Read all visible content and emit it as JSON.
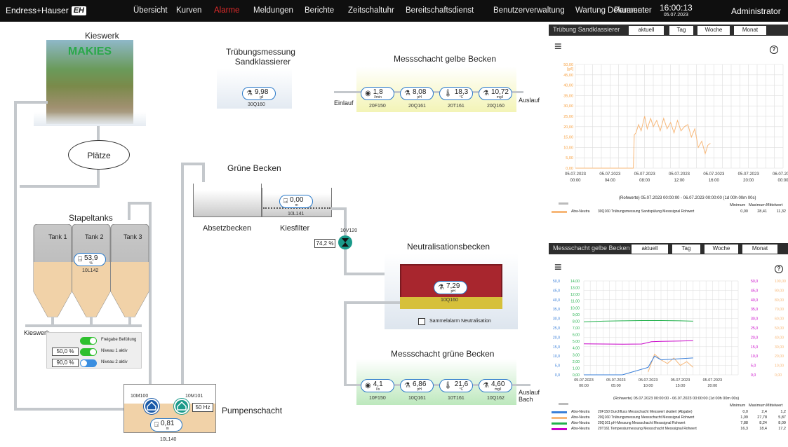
{
  "header": {
    "brand": "Endress+Hauser",
    "brand_logo": "EH",
    "nav": [
      "Übersicht",
      "Kurven",
      "Alarme",
      "Meldungen",
      "Berichte",
      "Zeitschaltuhr",
      "Bereitschaftsdienst",
      "Benutzerverwaltung",
      "Wartung",
      "Parameter",
      "Dokumente"
    ],
    "time": "16:00:13",
    "date": "05.07.2023",
    "user": "Administrator"
  },
  "plant": {
    "kieswerk": {
      "title": "Kieswerk",
      "logo": "MAKIES"
    },
    "plaetze": "Plätze",
    "truebung": {
      "title1": "Trübungsmessung",
      "title2": "Sandklassierer",
      "value": "9,98",
      "unit": "g/l",
      "tag": "30Q160"
    },
    "gelbe": {
      "title": "Messschacht gelbe Becken",
      "einlauf": "Einlauf",
      "auslauf": "Auslauf",
      "pills": [
        {
          "v": "1,8",
          "u": "l/min",
          "tag": "20F150"
        },
        {
          "v": "8,08",
          "u": "pH",
          "tag": "20Q161"
        },
        {
          "v": "18,3",
          "u": "°C",
          "tag": "20T161"
        },
        {
          "v": "10,72",
          "u": "mg/l",
          "tag": "20Q160"
        }
      ]
    },
    "gruene_becken": {
      "title": "Grüne Becken",
      "value": "0,00",
      "unit": "m",
      "tag": "10L141",
      "absetz": "Absetzbecken",
      "kies": "Kiesfilter"
    },
    "valve": {
      "tag": "10V120",
      "pct": "74,2 %"
    },
    "stapel": {
      "title": "Stapeltanks",
      "tanks": [
        "Tank 1",
        "Tank 2",
        "Tank 3"
      ],
      "value": "53,9",
      "unit": "%",
      "tag": "10L142"
    },
    "kieswerk_label": "Kieswerk",
    "controls": [
      {
        "pct": "",
        "label": "Freigabe Befüllung",
        "on": true
      },
      {
        "pct": "50,0 %",
        "label": "Niveau 1 aktiv",
        "on": true
      },
      {
        "pct": "90,0 %",
        "label": "Niveau 2 aktiv",
        "on": false
      }
    ],
    "neutral": {
      "title": "Neutralisationsbecken",
      "value": "7,29",
      "unit": "pH",
      "tag": "10Q160",
      "alarm": "Sammelalarm Neutralisation"
    },
    "gruen_schacht": {
      "title": "Messschacht grüne Becken",
      "auslauf1": "Auslauf",
      "auslauf2": "Bach",
      "pills": [
        {
          "v": "4,1",
          "u": "l/s",
          "tag": "10F150"
        },
        {
          "v": "6,86",
          "u": "pH",
          "tag": "10Q161"
        },
        {
          "v": "21,6",
          "u": "°C",
          "tag": "10T161"
        },
        {
          "v": "4,60",
          "u": "mg/l",
          "tag": "10Q162"
        }
      ]
    },
    "pump": {
      "title": "Pumpenschacht",
      "m1": "10M100",
      "m2": "10M101",
      "hz": "50 Hz",
      "value": "0,81",
      "unit": "m",
      "tag": "10L140"
    }
  },
  "panel1": {
    "title": "Trübung Sandklassierer",
    "tabs": [
      "aktuell",
      "Tag",
      "Woche",
      "Monat"
    ],
    "range": "(Rohwerte) 05.07.2023 00:00:00 - 06.07.2023 00:00:00 (1d 00h 00m 00s)",
    "stat_heads": [
      "Minimum",
      "Maximum",
      "Mittelwert"
    ],
    "legend": [
      {
        "src": "Abw-Neutra",
        "name": "30Q160 Trübungsmessung Sandspülung Messsignal Rohwert",
        "min": "0,00",
        "max": "28,41",
        "mean": "11,32",
        "color": "#f7b87a"
      }
    ]
  },
  "panel2": {
    "title": "Messschacht gelbe Becken",
    "tabs": [
      "aktuell",
      "Tag",
      "Woche",
      "Monat"
    ],
    "range": "(Rohwerte) 05.07.2023 00:00:00 - 06.07.2023 00:00:00 (1d 00h 00m 00s)",
    "stat_heads": [
      "Minimum",
      "Maximum",
      "Mittelwert"
    ],
    "legend": [
      {
        "src": "Abw-Neutra",
        "name": "20F150 Durchfluss Messschacht Messwert skaliert (Abgabe)",
        "min": "0,0",
        "max": "2,4",
        "mean": "1,2",
        "color": "#3a7fd8"
      },
      {
        "src": "Abw-Neutra",
        "name": "20Q160 Trübungsmessung Messschacht Messsignal Rohwert",
        "min": "1,09",
        "max": "27,78",
        "mean": "5,87",
        "color": "#f7b87a"
      },
      {
        "src": "Abw-Neutra",
        "name": "20Q161 pH-Messung Messschacht Messsignal Rohwert",
        "min": "7,88",
        "max": "8,24",
        "mean": "8,09",
        "color": "#22b14c"
      },
      {
        "src": "Abw-Neutra",
        "name": "20T161 Temperaturmessung Messschacht Messsignal Rohwert",
        "min": "16,3",
        "max": "18,4",
        "mean": "17,2",
        "color": "#c800c8"
      }
    ]
  },
  "chart_data": [
    {
      "type": "line",
      "title": "Trübung Sandklassierer",
      "ylabel": "[g/l]",
      "ylim": [
        0,
        50
      ],
      "yticks": [
        "0,00",
        "5,00",
        "10,00",
        "15,00",
        "20,00",
        "25,00",
        "30,00",
        "35,00",
        "40,00",
        "45,00",
        "50,00"
      ],
      "xticks": [
        "05.07.2023 00:00",
        "05.07.2023 04:00",
        "05.07.2023 08:00",
        "05.07.2023 12:00",
        "05.07.2023 16:00",
        "05.07.2023 20:00",
        "06.07.2023 00:00"
      ],
      "series": [
        {
          "name": "30Q160 Trübungsmessung Sandspülung Messsignal Rohwert",
          "color": "#f7b87a",
          "x": [
            0,
            6.7,
            6.8,
            7.0,
            7.3,
            7.6,
            8.0,
            8.3,
            8.7,
            9.0,
            9.4,
            9.8,
            10.2,
            10.6,
            11.0,
            11.4,
            11.8,
            12.2,
            12.6,
            13.0,
            13.4,
            13.8,
            14.2,
            14.6,
            15.0,
            15.3,
            15.6
          ],
          "values": [
            0,
            0,
            16,
            17,
            21,
            18,
            25,
            19,
            24,
            20,
            23,
            18,
            24,
            19,
            22,
            17,
            23,
            18,
            20,
            21,
            15,
            19,
            10,
            13,
            7,
            11,
            12
          ]
        }
      ]
    },
    {
      "type": "line",
      "title": "Messschacht gelbe Becken",
      "xticks": [
        "05.07.2023 00:00",
        "05.07.2023 05:00",
        "05.07.2023 10:00",
        "05.07.2023 15:00",
        "05.07.2023 20:00"
      ],
      "series": [
        {
          "name": "20Q161",
          "color": "#22b14c",
          "x": [
            0,
            3,
            6,
            9,
            12,
            15,
            17
          ],
          "values": [
            7.9,
            8.0,
            8.05,
            8.1,
            8.1,
            8.05,
            8.0
          ]
        },
        {
          "name": "20T161",
          "color": "#c800c8",
          "x": [
            0,
            3,
            6,
            9,
            10.5,
            12,
            15,
            17
          ],
          "values": [
            16.5,
            16.4,
            16.3,
            16.4,
            17.6,
            17.8,
            18.0,
            18.2
          ]
        },
        {
          "name": "20Q160",
          "color": "#f7b87a",
          "x": [
            10,
            11,
            12,
            13,
            14,
            15,
            16,
            17
          ],
          "values": [
            3,
            22,
            16,
            12,
            18,
            10,
            14,
            8
          ]
        },
        {
          "name": "20F150",
          "color": "#3a7fd8",
          "x": [
            0,
            6,
            10,
            11,
            12,
            17
          ],
          "values": [
            0,
            0,
            0.4,
            1.0,
            0.8,
            0.9
          ]
        }
      ]
    }
  ]
}
